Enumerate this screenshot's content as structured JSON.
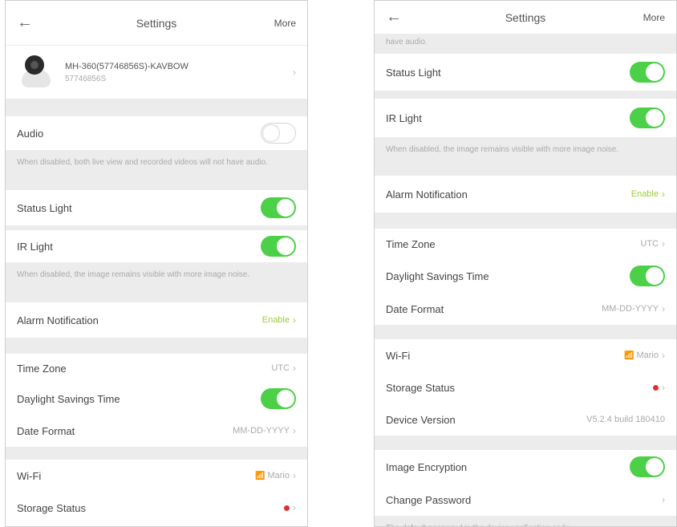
{
  "nav": {
    "title": "Settings",
    "more": "More",
    "back_glyph": "←"
  },
  "icons": {
    "back": "back-arrow-icon",
    "chevron": "chevron-right-icon",
    "wifi": "wifi-icon",
    "camera": "camera-icon"
  },
  "glyphs": {
    "chevron": "›",
    "wifi": "📶"
  },
  "colors": {
    "toggle_on": "#4cd048",
    "enable_text": "#9ccc3a",
    "status_dot": "#e03030"
  },
  "device": {
    "name": "MH-360(57746856S)-KAVBOW",
    "id": "57746856S"
  },
  "rows": {
    "audio": "Audio",
    "audio_note": "When disabled, both live view and recorded videos will not have audio.",
    "status_light": "Status Light",
    "ir_light": "IR Light",
    "ir_note": "When disabled, the image remains visible with more image noise.",
    "alarm_notification": "Alarm Notification",
    "alarm_value": "Enable",
    "time_zone": "Time Zone",
    "time_zone_value": "UTC",
    "dst": "Daylight Savings Time",
    "date_format": "Date Format",
    "date_format_value": "MM-DD-YYYY",
    "wifi": "Wi-Fi",
    "wifi_value": "Mario",
    "storage_status": "Storage Status",
    "device_version": "Device Version",
    "device_version_value": "V5.2.4 build 180410",
    "image_encryption": "Image Encryption",
    "change_password": "Change Password",
    "password_note": "The default password is the device verification code.",
    "partial_top": "have audio."
  },
  "toggles": {
    "audio": false,
    "status_light": true,
    "ir_light": true,
    "dst": true,
    "image_encryption": true
  }
}
